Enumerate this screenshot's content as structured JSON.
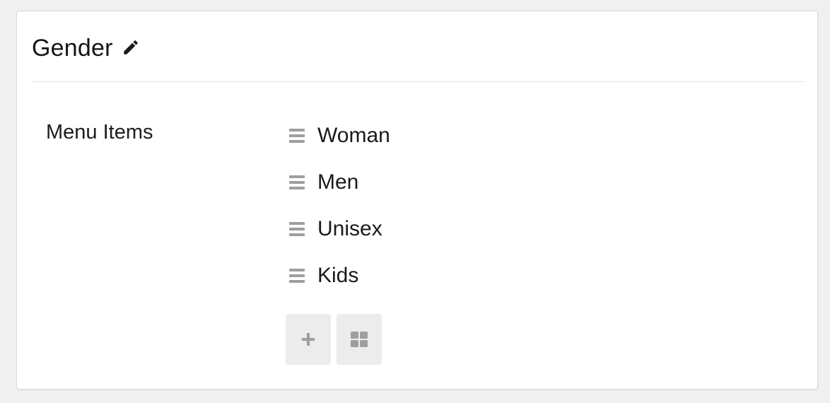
{
  "panel": {
    "title": "Gender",
    "edit_icon": "pencil-icon"
  },
  "field": {
    "label": "Menu Items"
  },
  "menu_items": [
    {
      "label": "Woman"
    },
    {
      "label": "Men"
    },
    {
      "label": "Unisex"
    },
    {
      "label": "Kids"
    }
  ],
  "actions": {
    "add_icon": "plus-icon",
    "grid_icon": "grid-icon"
  },
  "colors": {
    "background": "#f0f0f0",
    "card": "#ffffff",
    "text": "#1a1a1a",
    "icon_gray": "#9e9e9e",
    "button_bg": "#ececec"
  }
}
